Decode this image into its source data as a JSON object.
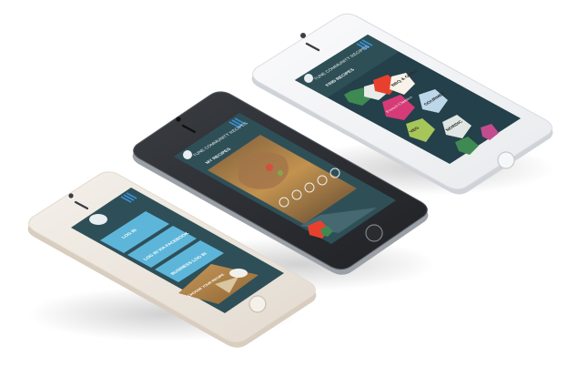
{
  "scene": {
    "description_free": true,
    "phone_colors": {
      "gold_body": "#e9e4dd",
      "gold_rim": "#d8cdbf",
      "space_gray_body": "#2a2c30",
      "space_gray_rim": "#9aa0a6",
      "silver_body": "#f2f3f5",
      "silver_rim": "#cfd3d8",
      "teal_header": "#2f4f57",
      "teal_dark": "#243d44",
      "menu_blue": "#3b8fd6",
      "button_blue": "#5db6d9"
    }
  },
  "phone_login": {
    "buttons": [
      {
        "label": "LOG IN"
      },
      {
        "label": "LOG IN VIA FACEBOOK"
      },
      {
        "label": "BUSINESS LOG IN"
      }
    ],
    "board_label": "CHOOSE YOUR RECIPE"
  },
  "phone_recipe": {
    "brand": "TUNE COMMUNITY RECIPES",
    "section_title": "MY RECIPES"
  },
  "phone_find": {
    "brand": "TUNE COMMUNITY RECIPES",
    "section_title": "FIND RECIPES",
    "labels": [
      {
        "text": "French Classics"
      },
      {
        "text": "GOURMET"
      },
      {
        "text": "NORDIC"
      },
      {
        "text": "BBQ & GRILL"
      },
      {
        "text": "VEG"
      }
    ]
  }
}
